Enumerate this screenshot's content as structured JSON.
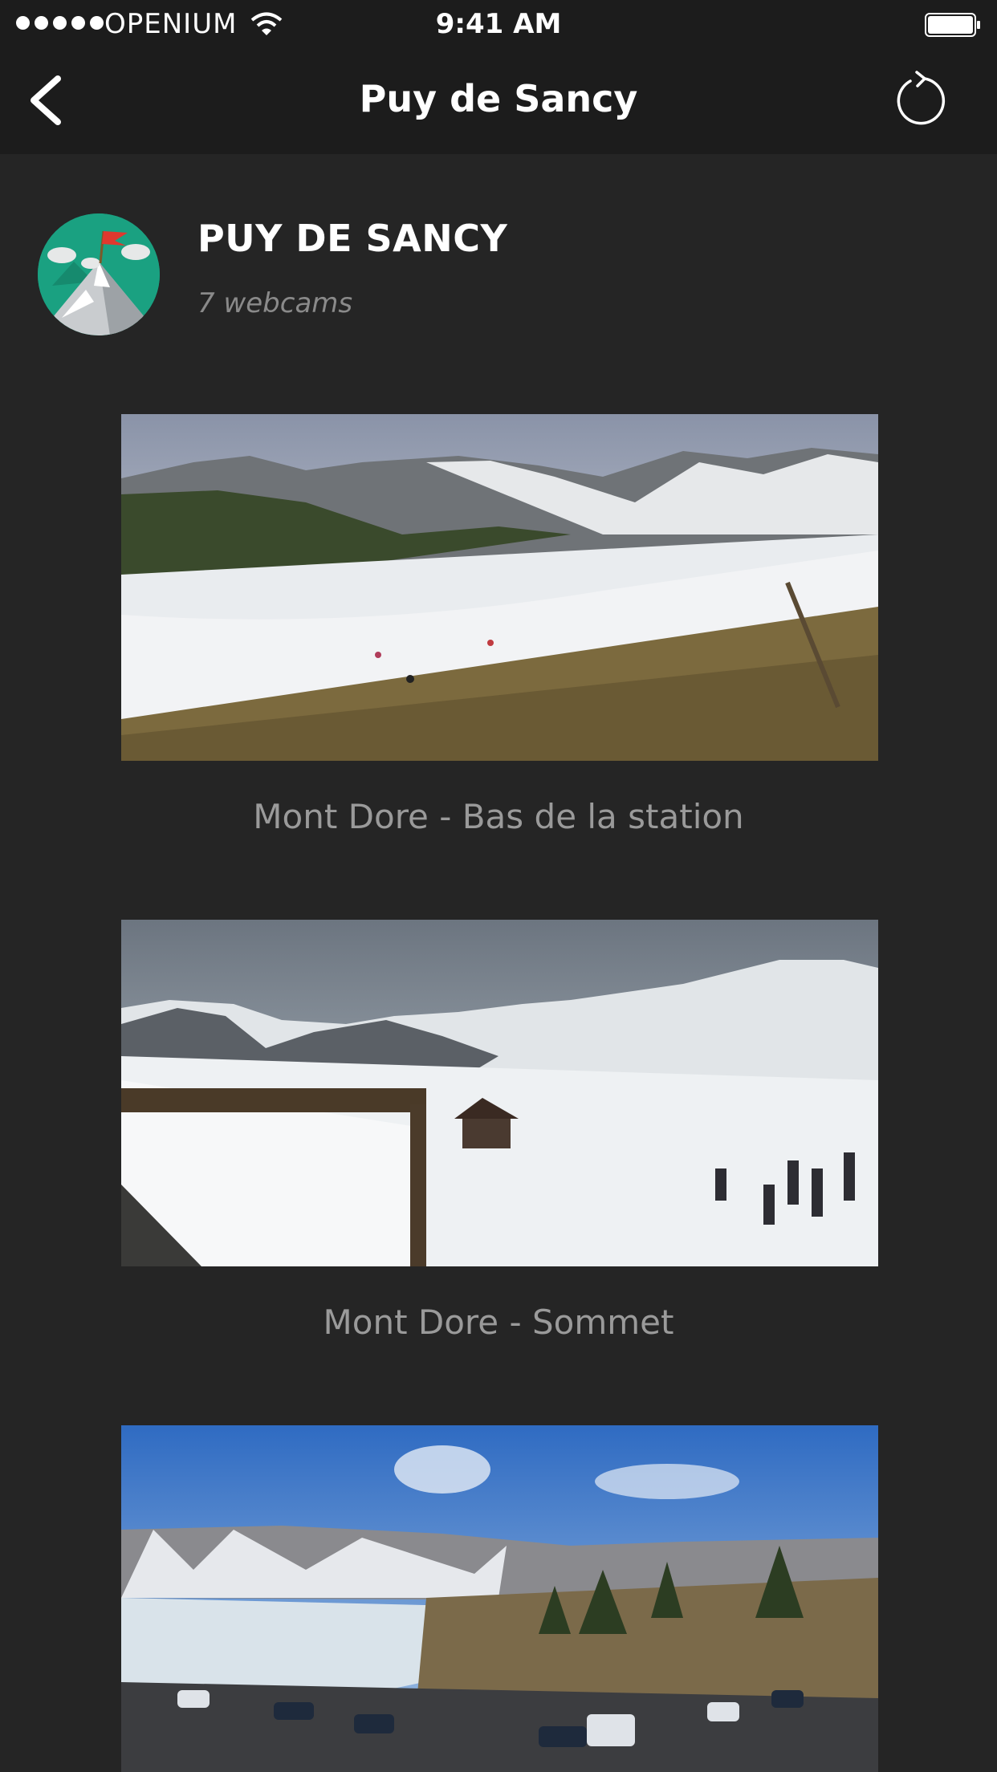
{
  "status_bar": {
    "carrier": "OPENIUM",
    "time": "9:41 AM"
  },
  "nav": {
    "title": "Puy de Sancy"
  },
  "header": {
    "name": "PUY DE SANCY",
    "count": "7 webcams"
  },
  "webcams": [
    {
      "label": "Mont Dore - Bas de la station"
    },
    {
      "label": "Mont Dore - Sommet"
    },
    {
      "label": ""
    }
  ],
  "icons": {
    "back": "chevron-left-icon",
    "refresh": "refresh-icon",
    "wifi": "wifi-icon",
    "battery": "battery-icon"
  }
}
